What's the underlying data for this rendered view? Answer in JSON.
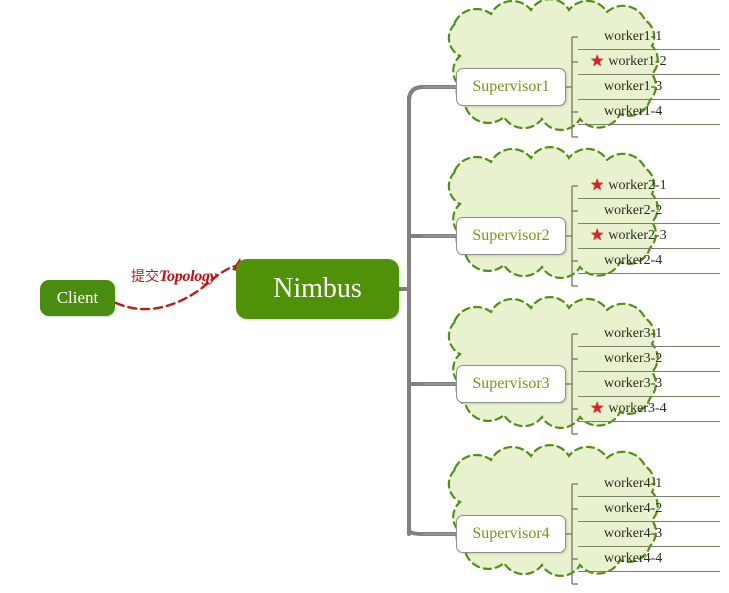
{
  "diagram": {
    "title": "Storm Nimbus Supervisor Worker Topology",
    "colors": {
      "node_green": "#4f9107",
      "cloud_fill": "#e8f2cf",
      "cloud_border": "#4f9211",
      "supervisor_text": "#6f9c12",
      "arrow_red": "#c41a1a",
      "star_red": "#dd1f26",
      "connector_gray": "#808080"
    }
  },
  "client": {
    "label": "Client"
  },
  "nimbus": {
    "label": "Nimbus"
  },
  "submit_edge": {
    "label_cn": "提交",
    "label_en": "Topology"
  },
  "supervisors": [
    {
      "label": "Supervisor1",
      "workers": [
        {
          "label": "worker1-1",
          "starred": false
        },
        {
          "label": "worker1-2",
          "starred": true
        },
        {
          "label": "worker1-3",
          "starred": false
        },
        {
          "label": "worker1-4",
          "starred": false
        }
      ]
    },
    {
      "label": "Supervisor2",
      "workers": [
        {
          "label": "worker2-1",
          "starred": true
        },
        {
          "label": "worker2-2",
          "starred": false
        },
        {
          "label": "worker2-3",
          "starred": true
        },
        {
          "label": "worker2-4",
          "starred": false
        }
      ]
    },
    {
      "label": "Supervisor3",
      "workers": [
        {
          "label": "worker3-1",
          "starred": false
        },
        {
          "label": "worker3-2",
          "starred": false
        },
        {
          "label": "worker3-3",
          "starred": false
        },
        {
          "label": "worker3-4",
          "starred": true
        }
      ]
    },
    {
      "label": "Supervisor4",
      "workers": [
        {
          "label": "worker4-1",
          "starred": false
        },
        {
          "label": "worker4-2",
          "starred": false
        },
        {
          "label": "worker4-3",
          "starred": false
        },
        {
          "label": "worker4-4",
          "starred": false
        }
      ]
    }
  ],
  "icons": {
    "star": "★"
  }
}
